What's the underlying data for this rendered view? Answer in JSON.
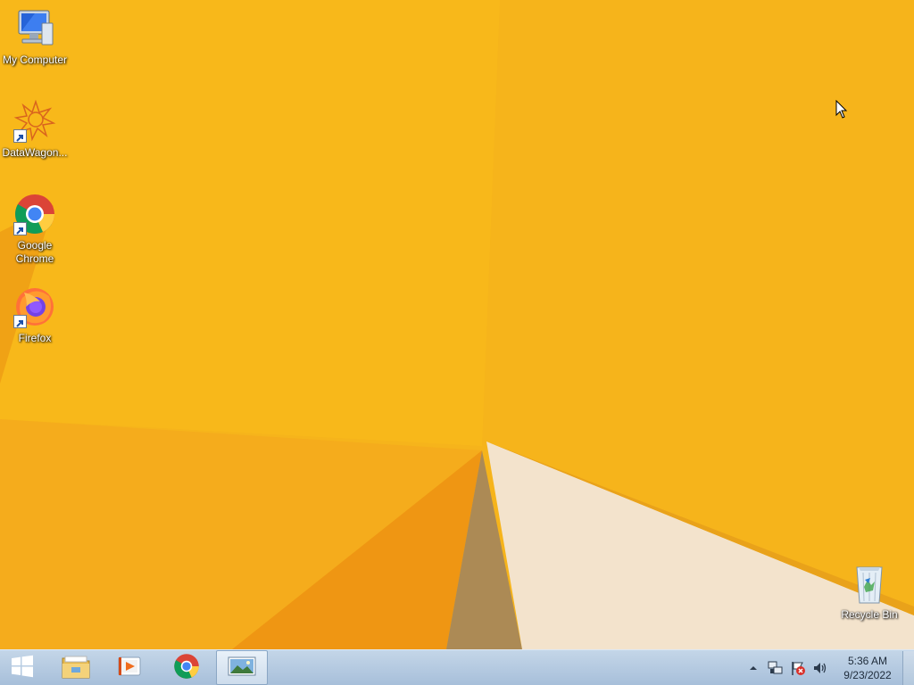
{
  "desktop": {
    "icons": [
      {
        "label": "My Computer",
        "icon": "computer-icon",
        "shortcut": false
      },
      {
        "label": "DataWagon...",
        "icon": "datawagon-icon",
        "shortcut": true
      },
      {
        "label": "Google Chrome",
        "icon": "chrome-icon",
        "shortcut": true
      },
      {
        "label": "Firefox",
        "icon": "firefox-icon",
        "shortcut": true
      },
      {
        "label": "Recycle Bin",
        "icon": "recycle-bin-icon",
        "shortcut": false
      }
    ]
  },
  "taskbar": {
    "start_icon": "windows-logo-icon",
    "pinned": [
      {
        "name": "File Explorer",
        "icon": "file-explorer-icon"
      },
      {
        "name": "Media Player",
        "icon": "media-player-icon"
      },
      {
        "name": "Google Chrome",
        "icon": "chrome-icon"
      },
      {
        "name": "Photos",
        "icon": "photo-viewer-icon",
        "active": true
      }
    ],
    "tray": {
      "icons": [
        "show-hidden-icons-chevron",
        "network-icon",
        "action-center-flag-icon",
        "volume-icon"
      ],
      "time": "5:36 AM",
      "date": "9/23/2022"
    }
  },
  "colors": {
    "wallpaper_base": "#f6b41b",
    "wallpaper_dark": "#ef9a13",
    "wallpaper_cream": "#f3e5d0",
    "taskbar": "#b3c8de"
  }
}
